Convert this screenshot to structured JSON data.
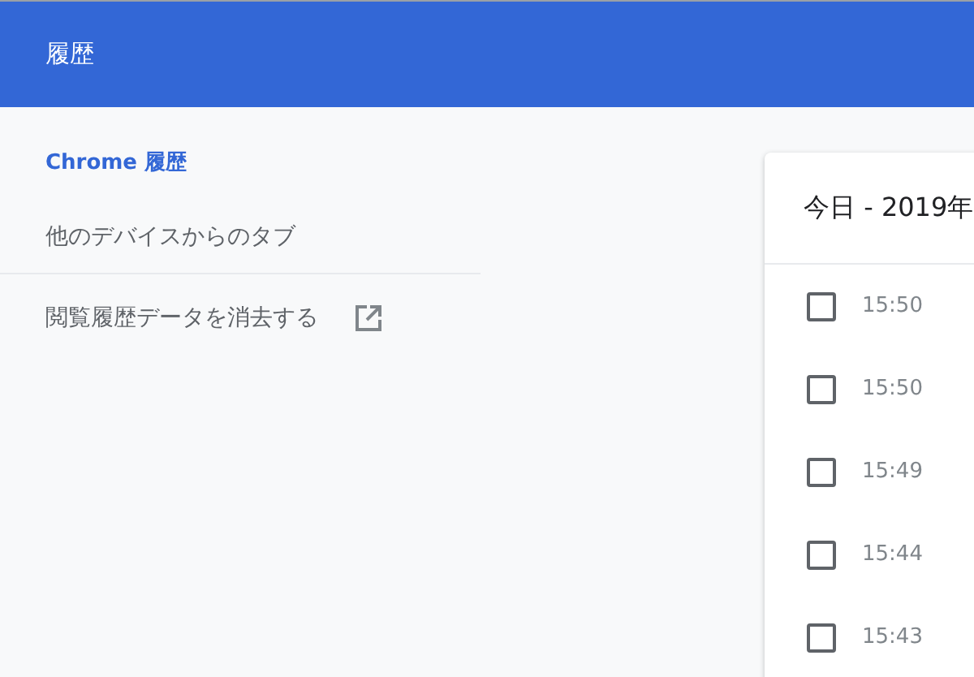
{
  "header": {
    "title": "履歴"
  },
  "sidebar": {
    "items": [
      {
        "label": "Chrome 履歴",
        "selected": true
      },
      {
        "label": "他のデバイスからのタブ",
        "selected": false
      }
    ],
    "clear_link": {
      "label": "閲覧履歴データを消去する"
    }
  },
  "card": {
    "title": "今日 - 2019年",
    "rows": [
      {
        "time": "15:50",
        "checked": false
      },
      {
        "time": "15:50",
        "checked": false
      },
      {
        "time": "15:49",
        "checked": false
      },
      {
        "time": "15:44",
        "checked": false
      },
      {
        "time": "15:43",
        "checked": false
      }
    ]
  }
}
